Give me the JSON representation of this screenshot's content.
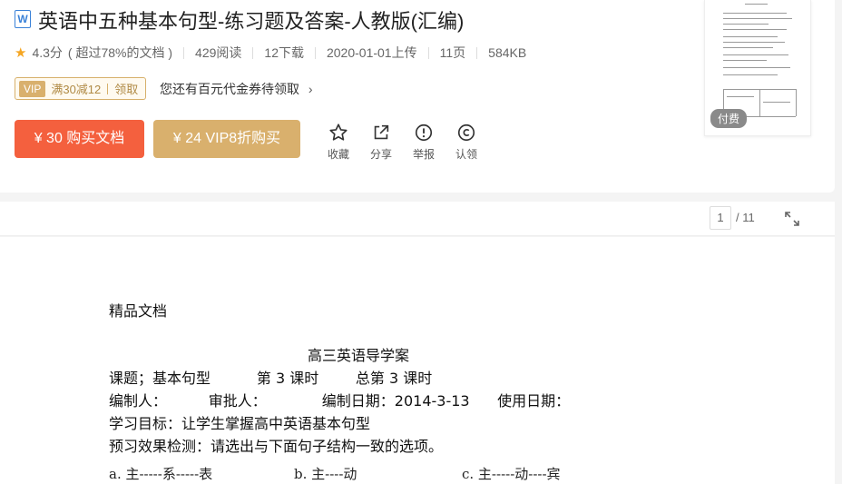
{
  "doc": {
    "format_icon": "W",
    "title": "英语中五种基本句型-练习题及答案-人教版(汇编)",
    "rating": "4.3分",
    "rating_note": "( 超过78%的文档 )",
    "reads": "429阅读",
    "downloads": "12下载",
    "upload_date": "2020-01-01上传",
    "pages": "11页",
    "size": "584KB"
  },
  "coupon": {
    "vip_label": "VIP",
    "offer": "满30减12",
    "claim": "领取",
    "hint": "您还有百元代金券待领取"
  },
  "buttons": {
    "buy": "¥ 30 购买文档",
    "vip_buy": "¥ 24 VIP8折购买"
  },
  "actions": [
    {
      "label": "收藏",
      "icon": "star-outline-icon"
    },
    {
      "label": "分享",
      "icon": "share-icon"
    },
    {
      "label": "举报",
      "icon": "report-icon"
    },
    {
      "label": "认领",
      "icon": "copyright-icon"
    }
  ],
  "thumbnail": {
    "badge": "付费"
  },
  "viewer": {
    "current_page": "1",
    "total": "/ 11"
  },
  "content": {
    "header": "精品文档",
    "heading": "高三英语导学案",
    "line1": "课题；基本句型          第 3 课时        总第 3 课时",
    "line2": "编制人：         审批人：            编制日期：2014-3-13      使用日期：",
    "line3": "学习目标：让学生掌握高中英语基本句型",
    "line4": "预习效果检测：请选出与下面句子结构一致的选项。",
    "opt_a": "a. 主-----系-----表",
    "opt_b": "b. 主----动",
    "opt_c": "c. 主-----动----宾"
  },
  "colors": {
    "accent": "#f4603e",
    "vip": "#d9b06d",
    "star": "#f5a623"
  }
}
